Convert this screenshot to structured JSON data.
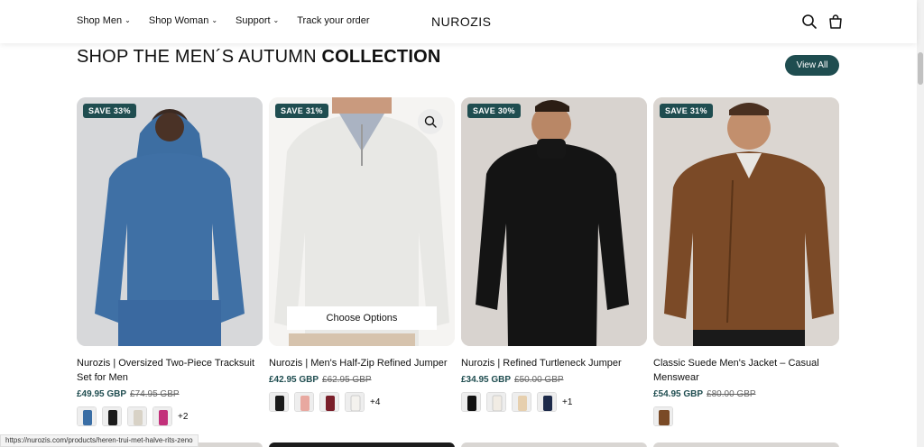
{
  "header": {
    "nav": [
      {
        "label": "Shop Men",
        "dropdown": true
      },
      {
        "label": "Shop Woman",
        "dropdown": true
      },
      {
        "label": "Support",
        "dropdown": true
      },
      {
        "label": "Track your order",
        "dropdown": false
      }
    ],
    "logo": "NUROZIS",
    "icons": [
      "search-icon",
      "cart-icon"
    ]
  },
  "section": {
    "title_light": "SHOP THE MEN´S AUTUMN ",
    "title_bold": "COLLECTION",
    "view_all": "View All"
  },
  "products": [
    {
      "badge": "SAVE 33%",
      "title": "Nurozis | Oversized Two-Piece Tracksuit Set for Men",
      "price": "£49.95 GBP",
      "compare": "£74.95 GBP",
      "swatch_colors": [
        "#3a6ea5",
        "#1b1b1b",
        "#d8d2c6",
        "#c2307a"
      ],
      "more": "+2",
      "image_bg": "#d9d9db",
      "garment": "#3e6fa3"
    },
    {
      "badge": "SAVE 31%",
      "title": "Nurozis | Men's Half-Zip Refined Jumper",
      "price": "£42.95 GBP",
      "compare": "£62.95 GBP",
      "swatch_colors": [
        "#1b1b1b",
        "#e8a8a0",
        "#7a1f2a",
        "#f4f2ee"
      ],
      "more": "+4",
      "choose": "Choose Options",
      "image_bg": "#f4f3f1",
      "garment": "#e9e9e6"
    },
    {
      "badge": "SAVE 30%",
      "title": "Nurozis | Refined Turtleneck Jumper",
      "price": "£34.95 GBP",
      "compare": "£50.00 GBP",
      "swatch_colors": [
        "#111111",
        "#f1ece4",
        "#e6cfae",
        "#1d2a4a"
      ],
      "more": "+1",
      "image_bg": "#d9d4d0",
      "garment": "#121212"
    },
    {
      "badge": "SAVE 31%",
      "title": "Classic Suede Men's Jacket – Casual Menswear",
      "price": "£54.95 GBP",
      "compare": "£80.00 GBP",
      "swatch_colors": [
        "#7a4a26"
      ],
      "more": "",
      "image_bg": "#dcd7d2",
      "garment": "#7b4a27"
    }
  ],
  "status_url": "https://nurozis.com/products/heren-trui-met-halve-rits-zeno"
}
